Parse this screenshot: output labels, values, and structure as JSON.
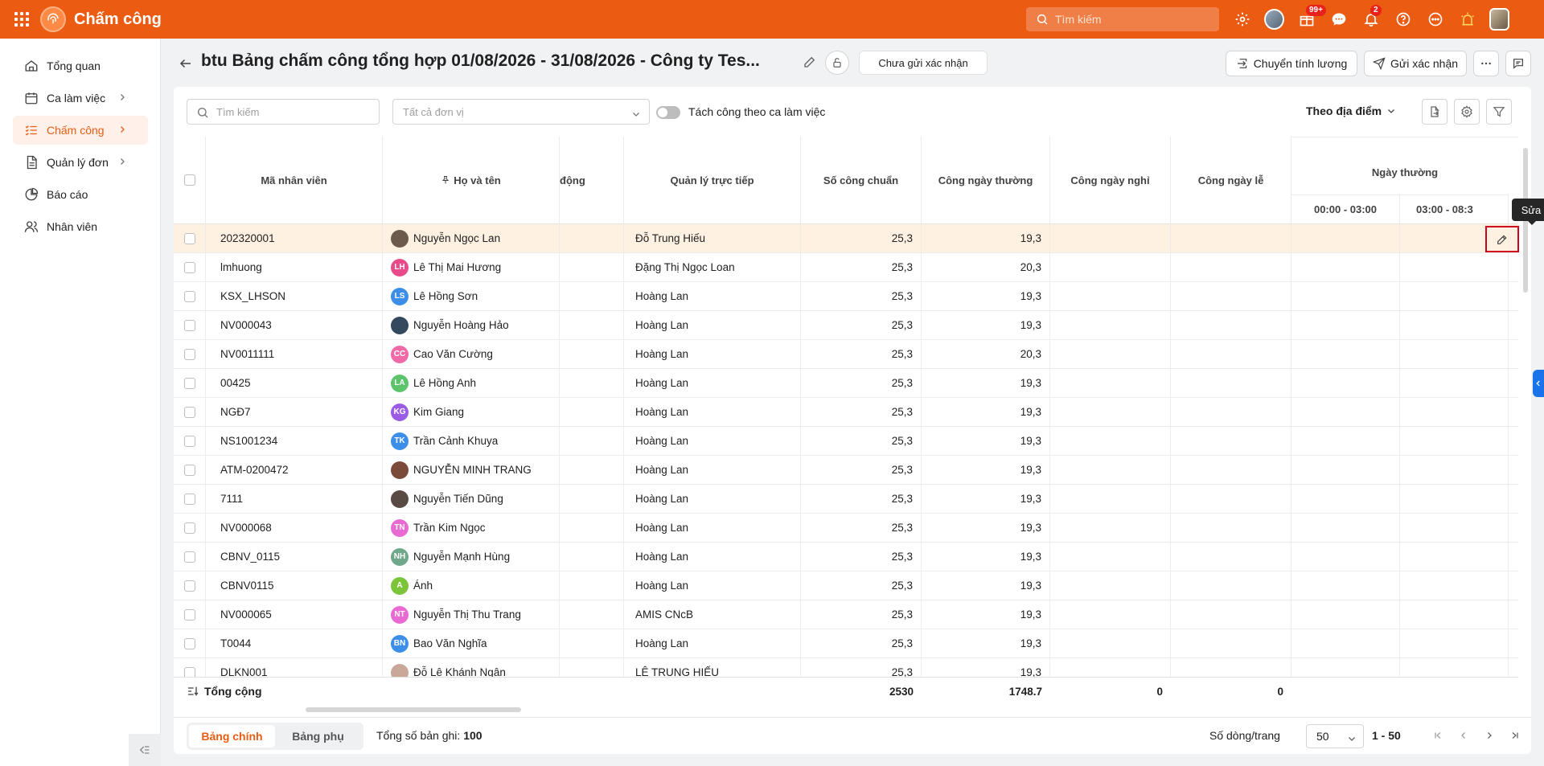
{
  "app": {
    "name": "Chấm công",
    "search_placeholder": "Tìm kiếm",
    "badges": {
      "gift": "99+",
      "notifications": "2"
    }
  },
  "sidebar": {
    "items": [
      {
        "label": "Tổng quan",
        "icon": "home-icon"
      },
      {
        "label": "Ca làm việc",
        "icon": "calendar-icon"
      },
      {
        "label": "Chấm công",
        "icon": "list-check-icon",
        "active": true
      },
      {
        "label": "Quản lý đơn",
        "icon": "document-icon"
      },
      {
        "label": "Báo cáo",
        "icon": "pie-chart-icon"
      },
      {
        "label": "Nhân viên",
        "icon": "users-icon"
      }
    ]
  },
  "header": {
    "title": "btu Bảng chấm công tổng hợp 01/08/2026 - 31/08/2026 - Công ty Tes...",
    "status": "Chưa gửi xác nhận",
    "transfer_label": "Chuyển tính lương",
    "send_label": "Gửi xác nhận"
  },
  "filters": {
    "search_placeholder": "Tìm kiếm",
    "unit_placeholder": "Tất cả đơn vị",
    "toggle_label": "Tách công theo ca làm việc",
    "group_by": "Theo địa điểm"
  },
  "table": {
    "columns": {
      "code": "Mã nhân viên",
      "name": "Họ và tên",
      "status_partial": "động",
      "manager": "Quản lý trực tiếp",
      "standard": "Số công chuẩn",
      "weekday": "Công ngày thường",
      "off": "Công ngày nghỉ",
      "holiday": "Công ngày lễ",
      "group": "Ngày thường",
      "sub1": "00:00 - 03:00",
      "sub2": "03:00 - 08:3"
    },
    "rows": [
      {
        "code": "202320001",
        "name": "Nguyễn Ngọc Lan",
        "initials": "",
        "avatar_color": "#6d5a4e",
        "manager": "Đỗ Trung Hiếu",
        "standard": "25,3",
        "weekday": "19,3"
      },
      {
        "code": "lmhuong",
        "name": "Lê Thị Mai Hương",
        "initials": "LH",
        "avatar_color": "#e84a8a",
        "manager": "Đặng Thị Ngọc Loan",
        "standard": "25,3",
        "weekday": "20,3"
      },
      {
        "code": "KSX_LHSON",
        "name": "Lê Hồng Sơn",
        "initials": "LS",
        "avatar_color": "#3d8ee8",
        "manager": "Hoàng Lan",
        "standard": "25,3",
        "weekday": "19,3"
      },
      {
        "code": "NV000043",
        "name": "Nguyễn Hoàng Hảo",
        "initials": "",
        "avatar_color": "#34495e",
        "manager": "Hoàng Lan",
        "standard": "25,3",
        "weekday": "19,3"
      },
      {
        "code": "NV0011111",
        "name": "Cao Văn Cường",
        "initials": "CC",
        "avatar_color": "#f06aa8",
        "manager": "Hoàng Lan",
        "standard": "25,3",
        "weekday": "20,3"
      },
      {
        "code": "00425",
        "name": "Lê Hồng Anh",
        "initials": "LA",
        "avatar_color": "#5cc46a",
        "manager": "Hoàng Lan",
        "standard": "25,3",
        "weekday": "19,3"
      },
      {
        "code": "NGĐ7",
        "name": "Kim Giang",
        "initials": "KG",
        "avatar_color": "#9b5de5",
        "manager": "Hoàng Lan",
        "standard": "25,3",
        "weekday": "19,3"
      },
      {
        "code": "NS1001234",
        "name": "Trần Cảnh Khuya",
        "initials": "TK",
        "avatar_color": "#3d8ee8",
        "manager": "Hoàng Lan",
        "standard": "25,3",
        "weekday": "19,3"
      },
      {
        "code": "ATM-0200472",
        "name": "NGUYỄN MINH TRANG",
        "initials": "",
        "avatar_color": "#7a4a3a",
        "manager": "Hoàng Lan",
        "standard": "25,3",
        "weekday": "19,3"
      },
      {
        "code": "7111",
        "name": "Nguyễn Tiến Dũng",
        "initials": "",
        "avatar_color": "#5a4a44",
        "manager": "Hoàng Lan",
        "standard": "25,3",
        "weekday": "19,3"
      },
      {
        "code": "NV000068",
        "name": "Trần Kim Ngọc",
        "initials": "TN",
        "avatar_color": "#e86ad2",
        "manager": "Hoàng Lan",
        "standard": "25,3",
        "weekday": "19,3"
      },
      {
        "code": "CBNV_0115",
        "name": "Nguyễn Mạnh Hùng",
        "initials": "NH",
        "avatar_color": "#6fa88a",
        "manager": "Hoàng Lan",
        "standard": "25,3",
        "weekday": "19,3"
      },
      {
        "code": "CBNV0115",
        "name": "Ánh",
        "initials": "A",
        "avatar_color": "#7cc43a",
        "manager": "Hoàng Lan",
        "standard": "25,3",
        "weekday": "19,3"
      },
      {
        "code": "NV000065",
        "name": "Nguyễn Thị Thu Trang",
        "initials": "NT",
        "avatar_color": "#e86ad2",
        "manager": "AMIS CNcB",
        "standard": "25,3",
        "weekday": "19,3"
      },
      {
        "code": "T0044",
        "name": "Bao Văn Nghĩa",
        "initials": "BN",
        "avatar_color": "#3d8ee8",
        "manager": "Hoàng Lan",
        "standard": "25,3",
        "weekday": "19,3"
      },
      {
        "code": "DLKN001",
        "name": "Đỗ Lê Khánh Ngân",
        "initials": "",
        "avatar_color": "#c9a89a",
        "manager": "LÊ TRUNG HIẾU",
        "standard": "25,3",
        "weekday": "19,3"
      }
    ],
    "totals": {
      "label": "Tổng cộng",
      "standard": "2530",
      "weekday": "1748.7",
      "off": "0",
      "holiday": "0"
    },
    "edit_tooltip": "Sửa"
  },
  "footer": {
    "tab_main": "Bảng chính",
    "tab_sub": "Bảng phụ",
    "records_label": "Tổng số bản ghi:",
    "records_count": "100",
    "per_page_label": "Số dòng/trang",
    "per_page": "50",
    "range": "1 - 50"
  },
  "colors": {
    "brand": "#eb5c12",
    "selected_row": "#fff1e2",
    "highlight_border": "#d0021b"
  }
}
